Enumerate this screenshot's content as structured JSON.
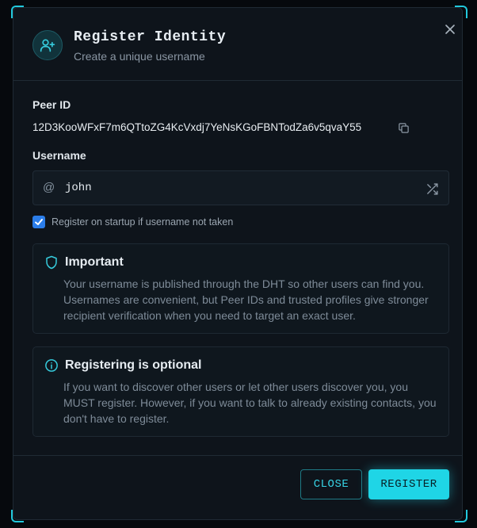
{
  "header": {
    "title": "Register Identity",
    "subtitle": "Create a unique username",
    "icon": "user-plus-icon"
  },
  "peer": {
    "label": "Peer ID",
    "value": "12D3KooWFxF7m6QTtoZG4KcVxdj7YeNsKGoFBNTodZa6v5qvaY55"
  },
  "username": {
    "label": "Username",
    "prefix": "@",
    "value": "john"
  },
  "startup_checkbox": {
    "checked": true,
    "label": "Register on startup if username not taken"
  },
  "notices": [
    {
      "icon": "shield-icon",
      "title": "Important",
      "body": "Your username is published through the DHT so other users can find you. Usernames are convenient, but Peer IDs and trusted profiles give stronger recipient verification when you need to target an exact user."
    },
    {
      "icon": "info-circle-icon",
      "title": "Registering is optional",
      "body": "If you want to discover other users or let other users discover you, you MUST register. However, if you want to talk to already existing contacts, you don't have to register."
    }
  ],
  "footer": {
    "close_label": "CLOSE",
    "register_label": "REGISTER"
  },
  "colors": {
    "accent": "#1fd5e6",
    "checkbox": "#2b7de9",
    "background": "#0e141b"
  }
}
